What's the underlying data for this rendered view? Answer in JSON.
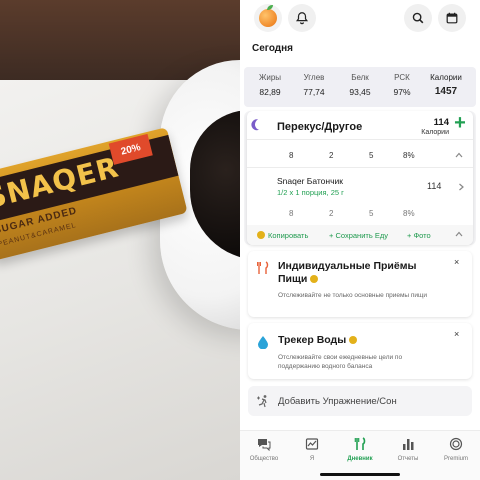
{
  "photo": {
    "bar_brand": "SNAQER",
    "bar_badge": "20%",
    "bar_subtitle": "SUGAR ADDED",
    "bar_flavor": "PEANUT&CARAMEL"
  },
  "header": {
    "date_label": "Сегодня",
    "icons": [
      "peach-logo-icon",
      "bell-icon",
      "search-icon",
      "calendar-icon"
    ]
  },
  "totals": {
    "fat_label": "Жиры",
    "fat_value": "82,89",
    "carbs_label": "Углев",
    "carbs_value": "77,74",
    "protein_label": "Белк",
    "protein_value": "93,45",
    "rdi_label": "РСК",
    "rdi_value": "97%",
    "calories_label": "Калории",
    "calories_value": "1457"
  },
  "meal": {
    "title": "Перекус/Другое",
    "calories": "114",
    "calories_label": "Калории",
    "fat": "8",
    "carbs": "2",
    "protein": "5",
    "rdi": "8%",
    "food": {
      "name": "Snaqer Батончик",
      "portion": "1/2 x 1 порция, 25 г",
      "calories": "114",
      "fat": "8",
      "carbs": "2",
      "protein": "5",
      "rdi": "8%"
    },
    "actions": {
      "copy": "Копировать",
      "save": "+ Сохранить Еду",
      "photo": "+ Фото"
    }
  },
  "promos": [
    {
      "title": "Индивидуальные Приёмы Пищи",
      "description": "Отслеживайте не только основные приемы пищи",
      "close": "×"
    },
    {
      "title": "Трекер Воды",
      "description": "Отслеживайте свои ежедневные цели по поддержанию водного баланса",
      "close": "×"
    }
  ],
  "exercise": {
    "label": "Добавить Упражнение/Сон"
  },
  "tabs": [
    {
      "label": "Общество",
      "icon": "chat-icon"
    },
    {
      "label": "Я",
      "icon": "profile-chart-icon"
    },
    {
      "label": "Дневник",
      "icon": "fork-knife-icon",
      "active": true
    },
    {
      "label": "Отчеты",
      "icon": "bar-chart-icon"
    },
    {
      "label": "Premium",
      "icon": "premium-icon"
    }
  ],
  "colors": {
    "accent": "#22a053",
    "premium_coin": "#e3b11a",
    "moon": "#7a5cc9"
  }
}
